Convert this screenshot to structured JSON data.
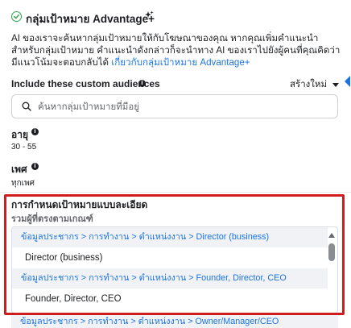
{
  "header": {
    "title": "กลุ่มเป้าหมาย Advantage+",
    "check_icon": "check-circle-icon",
    "sparkle_icon": "sparkle-icon",
    "description_text": "AI ของเราจะค้นหากลุ่มเป้าหมายให้กับโฆษณาของคุณ หากคุณเพิ่มคำแนะนำสำหรับกลุ่มเป้าหมาย คำแนะนำดังกล่าวก็จะนำทาง AI ของเราไปยังผู้คนที่คุณคิดว่ามีแนวโน้มจะตอบกลับได้ ",
    "description_link": "เกี่ยวกับกลุ่มเป้าหมาย Advantage+"
  },
  "custom_audiences": {
    "label": "Include these custom audiences",
    "create_new_label": "สร้างใหม่",
    "search_placeholder": "ค้นหากลุ่มเป้าหมายที่มีอยู่"
  },
  "age": {
    "label": "อายุ",
    "value": "30 - 55"
  },
  "gender": {
    "label": "เพศ",
    "value": "ทุกเพศ"
  },
  "detailed_targeting": {
    "title": "การกำหนดเป้าหมายแบบละเอียด",
    "subtitle": "รวมผู้ที่ตรงตามเกณฑ์",
    "entries": [
      {
        "path": "ข้อมูลประชากร > การทำงาน > ตำแหน่งงาน > Director (business)",
        "item": "Director (business)"
      },
      {
        "path": "ข้อมูลประชากร > การทำงาน > ตำแหน่งงาน > Founder, Director, CEO",
        "item": "Founder, Director, CEO"
      }
    ],
    "next_path": "ข้อมูลประชากร > การทำงาน > ตำแหน่งงาน > Owner/Manager/CEO"
  },
  "colors": {
    "accent": "#1b74e4",
    "success": "#31a24c",
    "highlight_border": "#d01c1c"
  }
}
